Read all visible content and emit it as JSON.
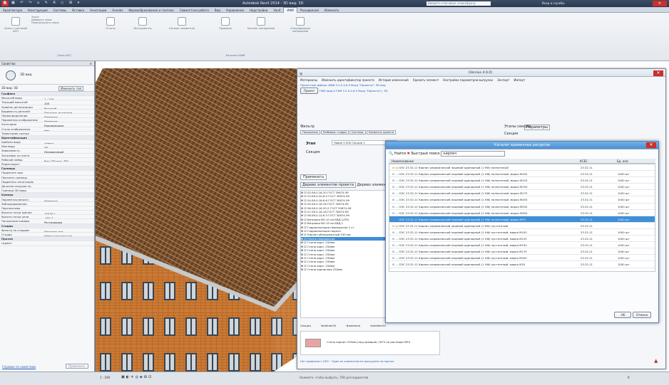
{
  "app": {
    "title": "Autodesk Revit 2014 -   3D вид: 3D",
    "search_placeholder": "Введите ключевое слово/фразу",
    "signin": "Вход в службы"
  },
  "ribbon": {
    "tabs": [
      "Архитектура",
      "Конструкция",
      "Системы",
      "Вставка",
      "Аннотации",
      "Анализ",
      "Формообразование и генплан",
      "Совместная работа",
      "Вид",
      "Управление",
      "Надстройки",
      "Vault",
      "ИФИ",
      "Расширения",
      "Изменить"
    ],
    "active_tab": "ИФИ",
    "buttons": [
      "Связь с системой ИСП",
      "Эскиз",
      "Добавить связь",
      "Перезагрузить связь",
      "Отчеты",
      "Инструменты",
      "Каталог элементов",
      "Проверка",
      "Каталог материалов",
      "Спецификация материалов"
    ],
    "groups": [
      "Связь ИСП",
      "Каталоги ИФИ"
    ]
  },
  "properties": {
    "title": "Свойства",
    "type": "3D вид",
    "view_select": "3D вид: 3D",
    "edit_type": "Изменить тип",
    "rows": [
      {
        "k": "Графика",
        "v": "",
        "sec": true
      },
      {
        "k": "Масштаб вида",
        "v": "1 : 100"
      },
      {
        "k": "Текущий масштаб",
        "v": "100"
      },
      {
        "k": "Уровень детализации",
        "v": "Высокий"
      },
      {
        "k": "Видимость деталей",
        "v": "Показать исходные"
      },
      {
        "k": "Переопределения",
        "v": "Изменить..."
      },
      {
        "k": "Параметры отображения",
        "v": "Изменить..."
      },
      {
        "k": "Категория",
        "v": "Координация"
      },
      {
        "k": "Стиль отображения",
        "v": "Нет"
      },
      {
        "k": "Траектория солнца",
        "v": ""
      },
      {
        "k": "Идентификация",
        "v": "",
        "sec": true
      },
      {
        "k": "Шаблон вида",
        "v": "<Нет>"
      },
      {
        "k": "Имя вида",
        "v": "3D"
      },
      {
        "k": "Зависимость",
        "v": "Независимый"
      },
      {
        "k": "Заголовок на листе",
        "v": ""
      },
      {
        "k": "Рабочий набор",
        "v": "Вид \"3D вид: 3D\""
      },
      {
        "k": "Редактирует",
        "v": ""
      },
      {
        "k": "Границы",
        "v": "",
        "sec": true
      },
      {
        "k": "Подрезать вид",
        "v": ""
      },
      {
        "k": "Показать границу",
        "v": ""
      },
      {
        "k": "Подрезать аннотацию",
        "v": ""
      },
      {
        "k": "Дальняя секущая пл.",
        "v": ""
      },
      {
        "k": "Границы 3D вида",
        "v": ""
      },
      {
        "k": "Камера",
        "v": "",
        "sec": true
      },
      {
        "k": "Параметры визуал.",
        "v": "Изменить..."
      },
      {
        "k": "Заблокированная",
        "v": ""
      },
      {
        "k": "Перспектива",
        "v": ""
      },
      {
        "k": "Высота точки зрения",
        "v": "15076.1"
      },
      {
        "k": "Высота точки цели",
        "v": "-400.7"
      },
      {
        "k": "Положение камеры",
        "v": "Регулировка"
      },
      {
        "k": "Стадии",
        "v": "",
        "sec": true
      },
      {
        "k": "Фильтр по стадиям",
        "v": "Показать все"
      },
      {
        "k": "Стадия",
        "v": "Новая конструкция"
      },
      {
        "k": "Прочее",
        "v": "",
        "sec": true
      },
      {
        "k": "гаджет",
        "v": ""
      }
    ],
    "help": "Справка по свойствам",
    "apply": "Применить"
  },
  "status": {
    "scale": "1 : 100",
    "left": "Нажмите, чтобы выбрать, TAB для вариантов",
    "zero": "0"
  },
  "project_window": {
    "title": "[Version 4.9.0]",
    "breadcrumb": "Проектные файлы: ИФИ 3.2.0.4.6.5 Вход \"Проекты\": 3D вид",
    "toolbar": [
      "Материалы",
      "Изменить идентификатор проекта",
      "История изменений",
      "Удалить элемент",
      "Настройка параметров выгрузки",
      "Экспорт",
      "Импорт"
    ],
    "project_btn": "Проект",
    "project_val": "ГФИ (вид в ГФИ 3.2.0.4.6.5 Вход \"Проекты\"), 3D",
    "filter_label": "Фильтр",
    "tabs": [
      "Положения",
      "Разбивка: стадии",
      "Системы",
      "Элементы проекта",
      "ИФИ"
    ],
    "stage_label": "Этап",
    "stage_val": "Новое 2.000 Секция 1",
    "section_label": "Секция",
    "params_label": "Этапы секции",
    "params_tab": "Параметры",
    "params_field": "Секция",
    "apply": "Применить",
    "tree_header": [
      "Дерево элементов проекта",
      "Дерево элементов"
    ],
    "tree": [
      "02.06.0.16-20 ГОСТ 30674-99",
      "03.06.0.20-6.5 ГОСТ 30674-99",
      "04.06.0.16-6.6 ГОСТ 30674-99",
      "05.06.0.16-18 ГОСТ 30674-99",
      "06.06.0.16-20.2 ГОСТ 30674-99",
      "07.06.0.16-18 ГОСТ 30674-99",
      "08.06.0.14-6.3 ГОСТ 30674-99",
      "Витражи ВЛ-10 ни КВД-1(ПУ)",
      "Витражи ВЛ-15 ни КВД-1",
      "Гидроизоляция перекрытия 2 ст",
      "Гидроизоляция подпол",
      "Кирпич облицовочный 250 мм",
      "Плиты перекрытия",
      "Стена кирп. 250мм",
      "Стена кирп. 250мм",
      "Стена кирп. 250мм",
      "Стена кирп. 250мм",
      "Стена кирп. 250мм",
      "Стена кирп. 250мм",
      "Стена кирп. 250мм",
      "Стена кирпичная 250мм"
    ],
    "tree_selected": 12,
    "bottom_tabs": [
      "Секция",
      "Vorbilder20",
      "Изменено",
      "Vorbilder20"
    ],
    "material": "Стена кирпич 250мм (под армиров.) М75 на растворе М50",
    "footer": "Нет привязки к ОКС",
    "footer2": "Один из элементов не выгружен на портал"
  },
  "catalog": {
    "title": "Каталог единичных ресурсов",
    "search_label": "Найти",
    "search_mode": "Быстрый поиск",
    "search_value": "кирпич",
    "columns": [
      "Наименование",
      "КСЕС",
      "Ед. изм"
    ],
    "rows": [
      {
        "n": "ОЭС 23.32.11 Кирпич керамический лицевой одинарный (1 НФ) полнотелый",
        "k": "23.32.11",
        "u": "",
        "g": true
      },
      {
        "n": "ОЭС 23.32.11 Кирпич керамический лицевой одинарный (1 НФ) полнотелый, марка М100",
        "k": "23.32.11",
        "u": "1000 шт"
      },
      {
        "n": "ОЭС 23.32.11 Кирпич керамический лицевой одинарный (1 НФ) полнотелый, марка М125",
        "k": "23.32.11",
        "u": "1000 шт"
      },
      {
        "n": "ОЭС 23.32.11 Кирпич керамический лицевой одинарный (1 НФ) полнотелый, марка М150",
        "k": "23.32.11",
        "u": "1000 шт"
      },
      {
        "n": "ОЭС 23.32.11 Кирпич керамический лицевой одинарный (1 НФ) полнотелый, марка М175",
        "k": "23.32.11",
        "u": "1000 шт"
      },
      {
        "n": "ОЭС 23.32.11 Кирпич керамический лицевой одинарный (1 НФ) полнотелый, марка М200",
        "k": "23.32.11",
        "u": "1000 шт"
      },
      {
        "n": "ОЭС 23.32.11 Кирпич керамический лицевой одинарный (1 НФ) полнотелый, марка М250",
        "k": "23.32.11",
        "u": "1000 шт"
      },
      {
        "n": "ОЭС 23.32.11 Кирпич керамический лицевой одинарный (1 НФ) полнотелый, марка М300",
        "k": "23.32.11",
        "u": "1000 шт"
      },
      {
        "n": "ОЭС 23.32.11 Кирпич керамический лицевой одинарный (1 НФ) полнотелый, марка М75",
        "k": "23.32.11",
        "u": "1000 шт",
        "sel": true
      },
      {
        "n": "ОЭС 23.32.11 Кирпич керамический лицевой одинарный (1 НФ) пустотелый",
        "k": "23.32.11",
        "u": "",
        "g": true
      },
      {
        "n": "ОЭС 23.32.11 Кирпич керамический лицевой одинарный (1 НФ) пустотелый, марка М100",
        "k": "23.32.11",
        "u": "1000 шт"
      },
      {
        "n": "ОЭС 23.32.11 Кирпич керамический лицевой одинарный (1 НФ) пустотелый, марка М125",
        "k": "23.32.11",
        "u": "1000 шт"
      },
      {
        "n": "ОЭС 23.32.11 Кирпич керамический лицевой одинарный (1 НФ) пустотелый, марка М150",
        "k": "23.32.11",
        "u": "1000 шт"
      },
      {
        "n": "ОЭС 23.32.11 Кирпич керамический лицевой одинарный (1 НФ) пустотелый, марка М175",
        "k": "23.32.11",
        "u": "1000 шт"
      },
      {
        "n": "ОЭС 23.32.11 Кирпич керамический лицевой одинарный (1 НФ) пустотелый, марка М200",
        "k": "23.32.11",
        "u": "1000 шт"
      },
      {
        "n": "ОЭС 23.32.11 Кирпич керамический лицевой одинарный (1 НФ) пустотелый, марка М25",
        "k": "23.32.11",
        "u": "1000 шт"
      }
    ],
    "ok": "OK",
    "cancel": "Отмена"
  },
  "colors": {
    "accent": "#3e8fd8",
    "brick": "#c9732c",
    "roof": "#8a5a30",
    "selection": "#3e8fd8"
  }
}
